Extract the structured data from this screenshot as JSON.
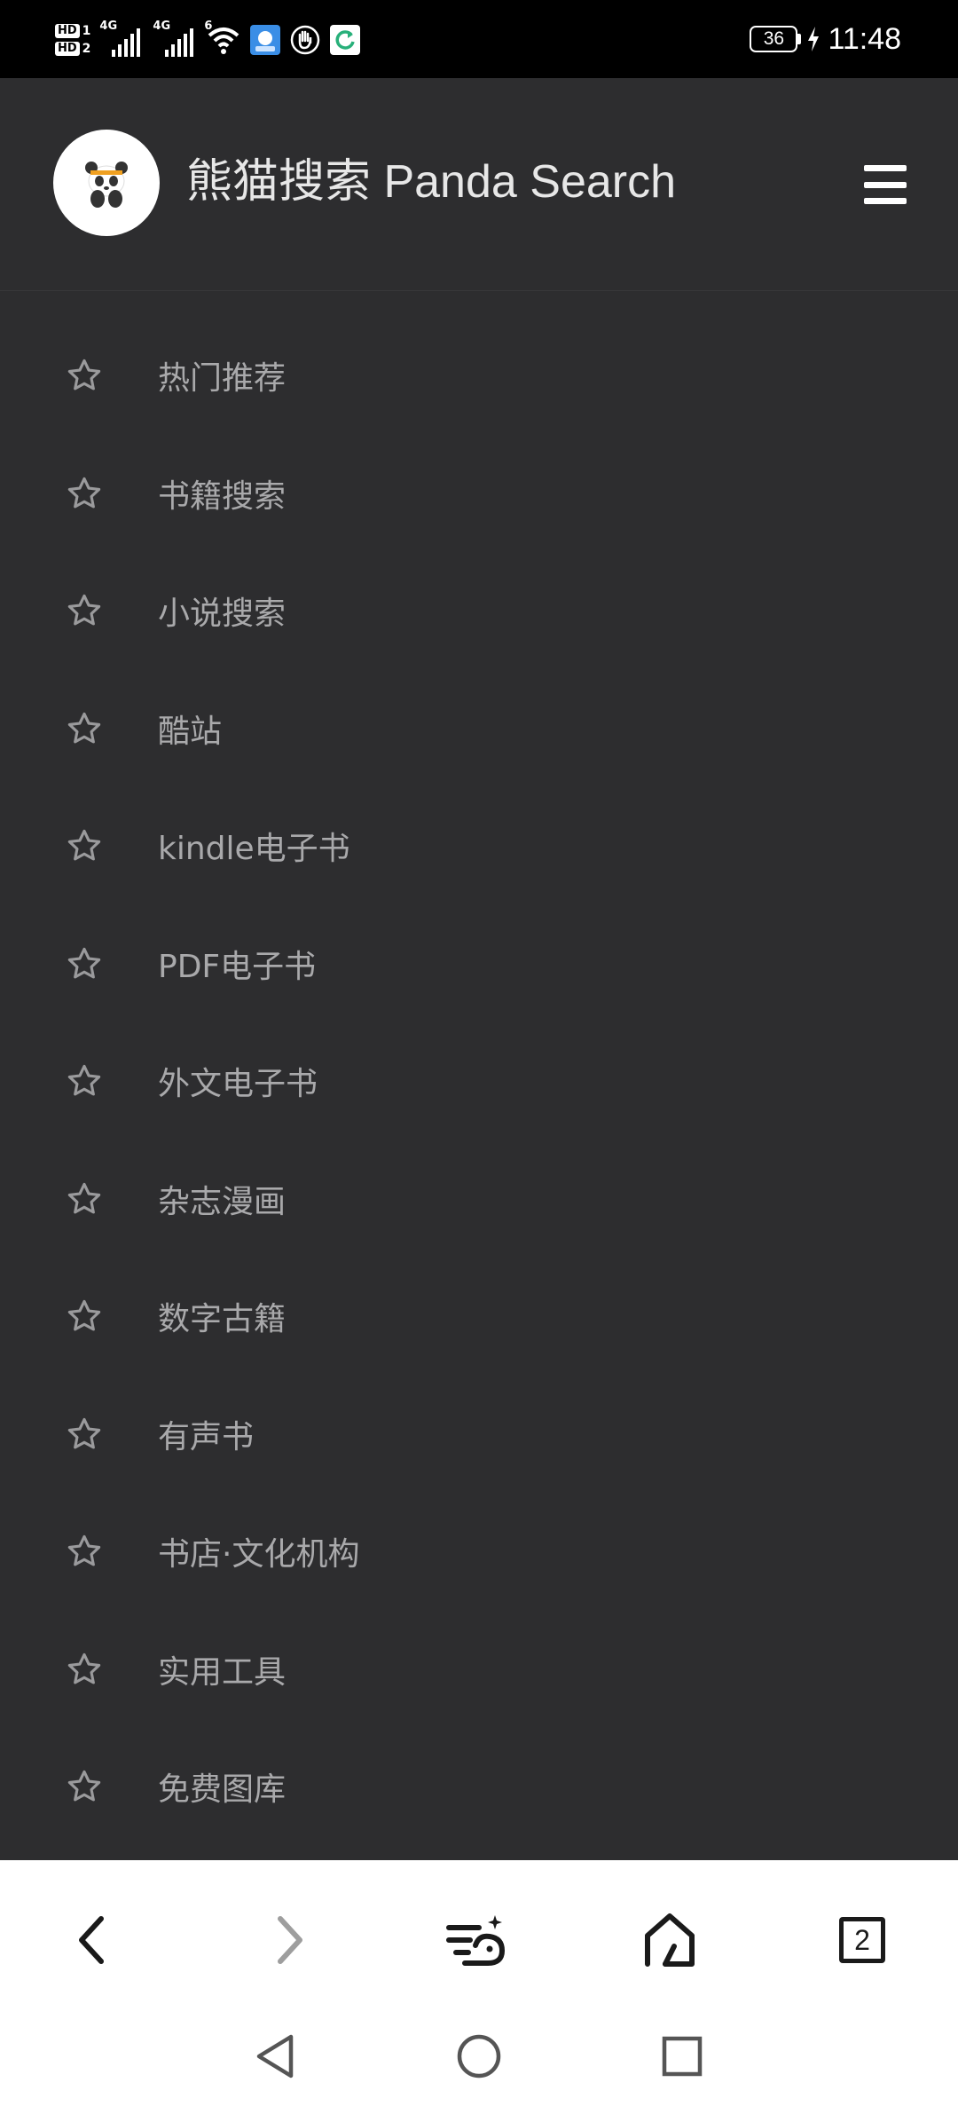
{
  "status_bar": {
    "sim1_badge": "HD",
    "sim1_num": "1",
    "sim2_badge": "HD",
    "sim2_num": "2",
    "network1": "4G",
    "network2": "4G",
    "wifi_label": "6",
    "battery_level": "36",
    "time": "11:48"
  },
  "header": {
    "title": "熊猫搜索 Panda Search",
    "menu_icon": "hamburger-icon",
    "logo_icon": "panda-logo-icon"
  },
  "menu": {
    "items": [
      {
        "label": "热门推荐"
      },
      {
        "label": "书籍搜索"
      },
      {
        "label": "小说搜索"
      },
      {
        "label": "酷站"
      },
      {
        "label": "kindle电子书"
      },
      {
        "label": "PDF电子书"
      },
      {
        "label": "外文电子书"
      },
      {
        "label": "杂志漫画"
      },
      {
        "label": "数字古籍"
      },
      {
        "label": "有声书"
      },
      {
        "label": "书店·文化机构"
      },
      {
        "label": "实用工具"
      },
      {
        "label": "免费图库"
      }
    ]
  },
  "toolbar": {
    "back_icon": "chevron-left-icon",
    "forward_icon": "chevron-right-icon",
    "feed_icon": "feed-sparkle-icon",
    "home_icon": "home-icon",
    "tab_count": "2"
  },
  "colors": {
    "background": "#2d2d2f",
    "menu_text": "#a9a9ab",
    "title_text": "#e7e7e7",
    "toolbar_bg": "#ffffff"
  }
}
